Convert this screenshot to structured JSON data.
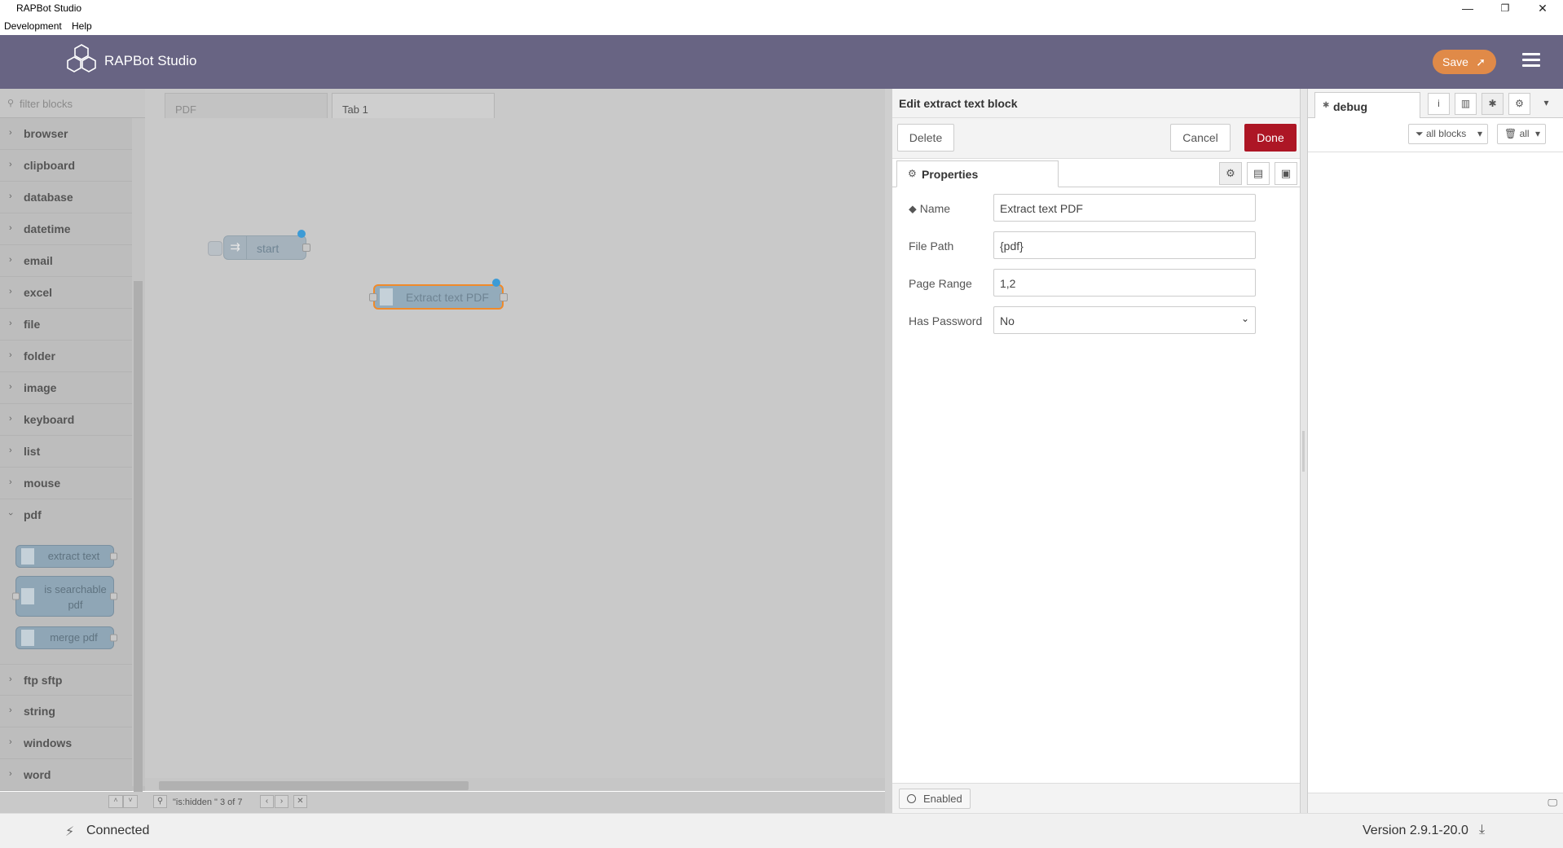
{
  "window": {
    "title": "RAPBot Studio",
    "controls": {
      "minimize": "—",
      "restore": "❐",
      "close": "✕"
    }
  },
  "menubar": {
    "items": [
      "Development",
      "Help"
    ]
  },
  "header": {
    "app_name": "RAPBot Studio",
    "save_label": "Save",
    "brand_color": "#686483",
    "save_color": "#e08a48"
  },
  "palette": {
    "filter_placeholder": "filter blocks",
    "categories_top": [
      "browser",
      "clipboard",
      "database",
      "datetime",
      "email",
      "excel",
      "file",
      "folder",
      "image",
      "keyboard",
      "list",
      "mouse",
      "pdf"
    ],
    "pdf_nodes": [
      "extract text",
      "is searchable pdf",
      "merge pdf"
    ],
    "categories_bottom": [
      "ftp sftp",
      "string",
      "windows",
      "word"
    ]
  },
  "workspace": {
    "tabs": [
      "PDF",
      "Tab 1"
    ],
    "nodes": [
      "start",
      "Extract text PDF"
    ],
    "search_status": "\"is:hidden \" 3 of 7"
  },
  "tray": {
    "title": "Edit extract text block",
    "delete_label": "Delete",
    "cancel_label": "Cancel",
    "done_label": "Done",
    "tab_label": "Properties",
    "fields": {
      "name_label": "Name",
      "name_value": "Extract text PDF",
      "filepath_label": "File Path",
      "filepath_value": "{pdf}",
      "pagerange_label": "Page Range",
      "pagerange_value": "1,2",
      "password_label": "Has Password",
      "password_value": "No"
    },
    "enabled_label": "Enabled",
    "done_color": "#ad1625"
  },
  "sidebar": {
    "tab_label": "debug",
    "filter_label": "all blocks",
    "clear_label": "all"
  },
  "status": {
    "connection": "Connected",
    "version": "Version 2.9.1-20.0"
  }
}
